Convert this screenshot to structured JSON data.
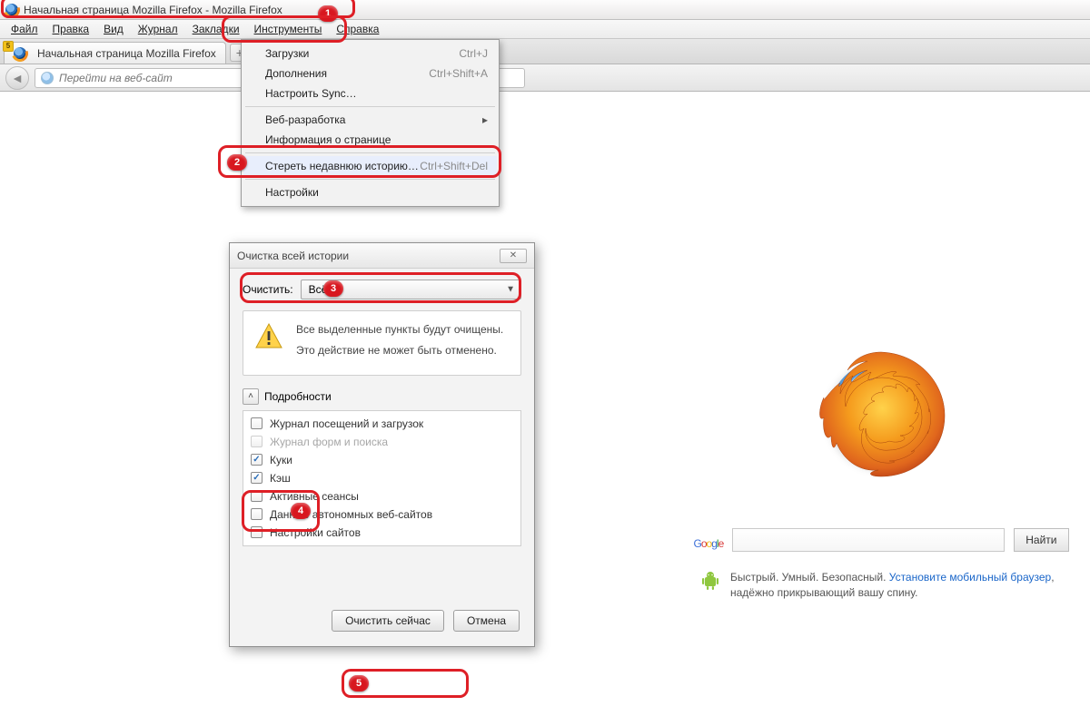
{
  "window": {
    "title": "Начальная страница Mozilla Firefox - Mozilla Firefox"
  },
  "menubar": {
    "file": "Файл",
    "edit": "Правка",
    "view": "Вид",
    "history": "Журнал",
    "bookmarks": "Закладки",
    "tools": "Инструменты",
    "help": "Справка"
  },
  "tab": {
    "label": "Начальная страница Mozilla Firefox"
  },
  "url": {
    "placeholder": "Перейти на веб-сайт"
  },
  "tools_menu": {
    "downloads": "Загрузки",
    "downloads_sc": "Ctrl+J",
    "addons": "Дополнения",
    "addons_sc": "Ctrl+Shift+A",
    "sync": "Настроить Sync…",
    "webdev": "Веб-разработка",
    "pageinfo": "Информация о странице",
    "clearhist": "Стереть недавнюю историю…",
    "clearhist_sc": "Ctrl+Shift+Del",
    "settings": "Настройки"
  },
  "dialog": {
    "title": "Очистка всей истории",
    "clear_label": "Очистить:",
    "range_value": "Всё",
    "warn1": "Все выделенные пункты будут очищены.",
    "warn2": "Это действие не может быть отменено.",
    "details": "Подробности",
    "items": {
      "visits": "Журнал посещений и загрузок",
      "forms": "Журнал форм и поиска",
      "cookies": "Куки",
      "cache": "Кэш",
      "sessions": "Активные сеансы",
      "offline": "Данные автономных веб-сайтов",
      "siteprefs": "Настройки сайтов"
    },
    "ok": "Очистить сейчас",
    "cancel": "Отмена"
  },
  "home": {
    "google_letters": [
      "G",
      "o",
      "o",
      "g",
      "l",
      "e"
    ],
    "search_btn": "Найти",
    "android_lead": "Быстрый. Умный. Безопасный. ",
    "android_link": "Установите мобильный браузер",
    "android_tail": ", надёжно прикрывающий вашу спину."
  },
  "callouts": {
    "n1": "1",
    "n2": "2",
    "n3": "3",
    "n4": "4",
    "n5": "5"
  }
}
